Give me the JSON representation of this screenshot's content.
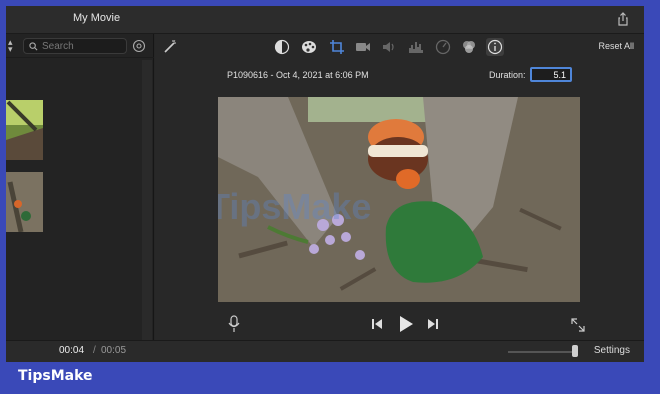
{
  "window": {
    "title": "My Movie"
  },
  "library": {
    "search_placeholder": "Search"
  },
  "viewer": {
    "reset_label": "Reset All",
    "clip_title": "P1090616 - Oct 4, 2021 at 6:06 PM",
    "duration_label": "Duration:",
    "duration_value": "5.1",
    "toolbar_icons": [
      "magic-wand-icon",
      "color-balance-icon",
      "color-correction-icon",
      "crop-icon",
      "stabilization-icon",
      "volume-icon",
      "noise-reduction-icon",
      "speed-icon",
      "clip-filter-icon",
      "info-icon"
    ],
    "playback_icons": [
      "microphone-icon",
      "skip-back-icon",
      "play-icon",
      "skip-forward-icon",
      "fullscreen-icon"
    ],
    "preview_watermark": "TipsMake"
  },
  "timeline": {
    "current_time": "00:04",
    "separator": "/",
    "total_time": "00:05",
    "settings_label": "Settings",
    "zoom_level": 0.9
  },
  "footer": {
    "brand": "TipsMake"
  },
  "colors": {
    "accent": "#4f86d9",
    "background": "#3a49b8"
  }
}
